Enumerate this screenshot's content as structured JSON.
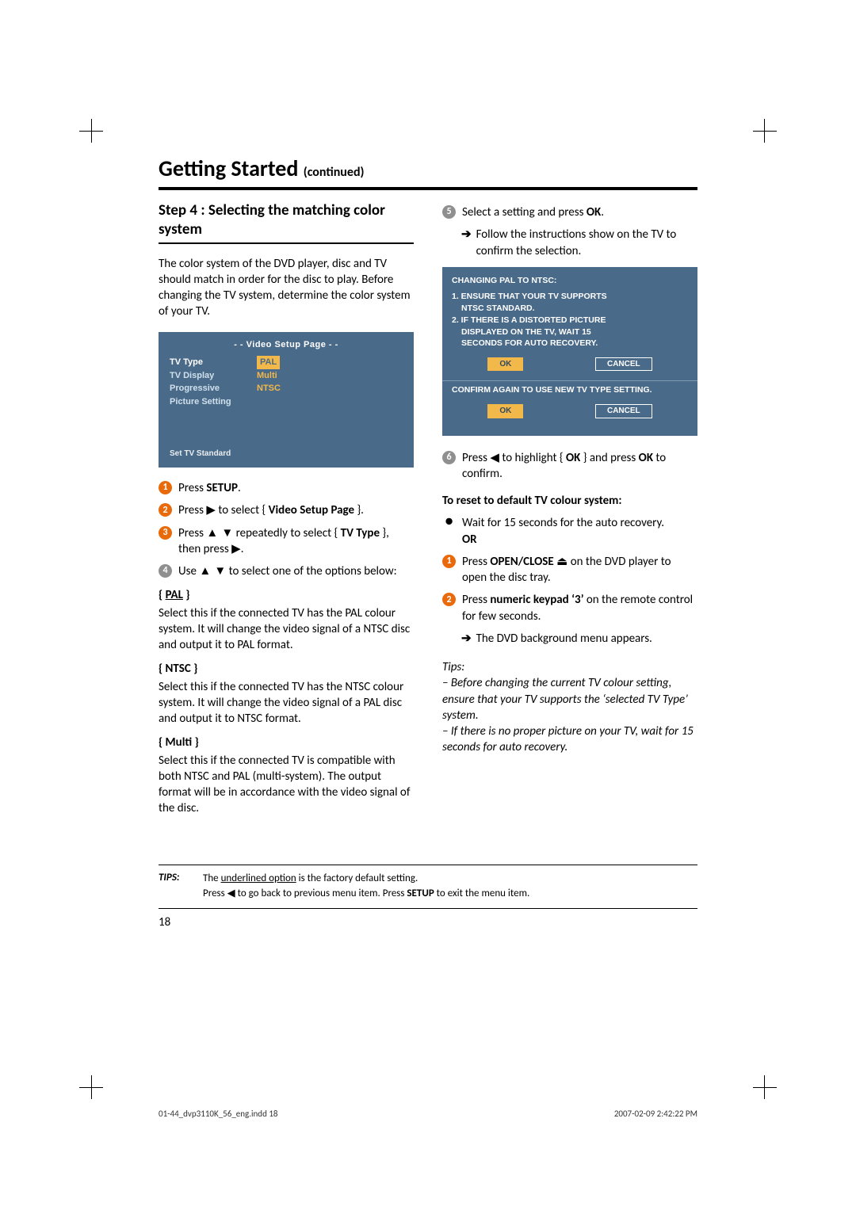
{
  "header": {
    "title": "Getting Started",
    "continued": "(continued)"
  },
  "step_heading": "Step 4 : Selecting the matching color system",
  "intro": "The color system of the DVD player, disc and TV should match in order for the disc to play. Before changing the TV system, determine the color system of your TV.",
  "osd": {
    "title": "- -   Video Setup Page   - -",
    "rows": [
      {
        "k": "TV Type",
        "v": "PAL",
        "sel": true
      },
      {
        "k": "TV Display",
        "v": "Multi",
        "sel": false
      },
      {
        "k": "Progressive",
        "v": "NTSC",
        "sel": false
      },
      {
        "k": "Picture Setting",
        "v": "",
        "sel": false
      }
    ],
    "footer": "Set TV Standard"
  },
  "steps_left": [
    {
      "n": "1",
      "pre": "Press ",
      "bold": "SETUP",
      "post": "."
    },
    {
      "n": "2",
      "pre": "Press ",
      "sym": "▶",
      "mid": " to select { ",
      "bold": "Video Setup Page",
      "post": " }."
    },
    {
      "n": "3",
      "pre": "Press ",
      "sym": "▲ ▼",
      "mid": " repeatedly to select { ",
      "bold": "TV Type",
      "post2": " }, then press ",
      "sym2": "▶",
      "post": "."
    },
    {
      "n": "4",
      "pre": "Use ",
      "sym": "▲ ▼",
      "post": " to select one of the options below:"
    }
  ],
  "options": [
    {
      "head": "{ PAL }",
      "ul": true,
      "body": "Select this if the connected TV has the PAL colour system. It will change the video signal of a NTSC disc and output it to PAL format."
    },
    {
      "head": "{ NTSC }",
      "ul": false,
      "body": "Select this if the connected TV has the NTSC colour system. It will change the video signal of a PAL disc and output it to NTSC format."
    },
    {
      "head": "{ Multi }",
      "ul": false,
      "body": "Select this if the connected TV is compatible with both NTSC and PAL (multi-system). The output format will be in accordance with the video signal of the disc."
    }
  ],
  "steps_right": {
    "s5": {
      "n": "5",
      "pre": "Select a setting and press ",
      "bold": "OK",
      "post": "."
    },
    "s5_sub": "Follow the instructions show on the TV to confirm the selection.",
    "s6": {
      "n": "6",
      "pre": "Press ",
      "sym": "◀",
      "mid": " to highlight { ",
      "bold": "OK",
      "post": " } and press ",
      "bold2": "OK",
      "post2": " to confirm."
    }
  },
  "dialog": {
    "line0": "CHANGING PAL TO NTSC:",
    "line1": "1. ENSURE THAT YOUR TV SUPPORTS",
    "line1b": "NTSC STANDARD.",
    "line2": "2. IF THERE IS A DISTORTED PICTURE",
    "line2b": "DISPLAYED ON THE TV, WAIT 15",
    "line2c": "SECONDS FOR AUTO RECOVERY.",
    "ok": "OK",
    "cancel": "CANCEL",
    "confirm": "CONFIRM AGAIN TO USE NEW TV TYPE SETTING."
  },
  "reset": {
    "head": "To reset to default TV colour system:",
    "wait": "Wait for 15 seconds for the auto recovery.",
    "or": "OR",
    "r1_pre": "Press ",
    "r1_bold": "OPEN/CLOSE",
    "r1_sym": " ⏏",
    "r1_post": " on the DVD player to open the disc tray.",
    "r2_pre": "Press ",
    "r2_bold": "numeric keypad ‘3’",
    "r2_post": " on the remote control for few seconds.",
    "r2_sub": "The DVD background menu appears."
  },
  "tips_inline": {
    "head": "Tips:",
    "t1": "– Before changing the current TV colour setting, ensure that your TV supports the ‘selected TV Type’ system.",
    "t2": "– If there is no proper picture on your TV, wait for 15 seconds for auto recovery."
  },
  "tips_footer": {
    "label": "TIPS:",
    "line1a": "The ",
    "line1u": "underlined option",
    "line1b": " is the factory default setting.",
    "line2a": "Press ",
    "line2sym": "◀",
    "line2b": " to go back to previous menu item. Press ",
    "line2bold": "SETUP",
    "line2c": " to exit the menu item."
  },
  "pagenum": "18",
  "meta_left": "01-44_dvp3110K_56_eng.indd   18",
  "meta_right": "2007-02-09   2:42:22 PM"
}
